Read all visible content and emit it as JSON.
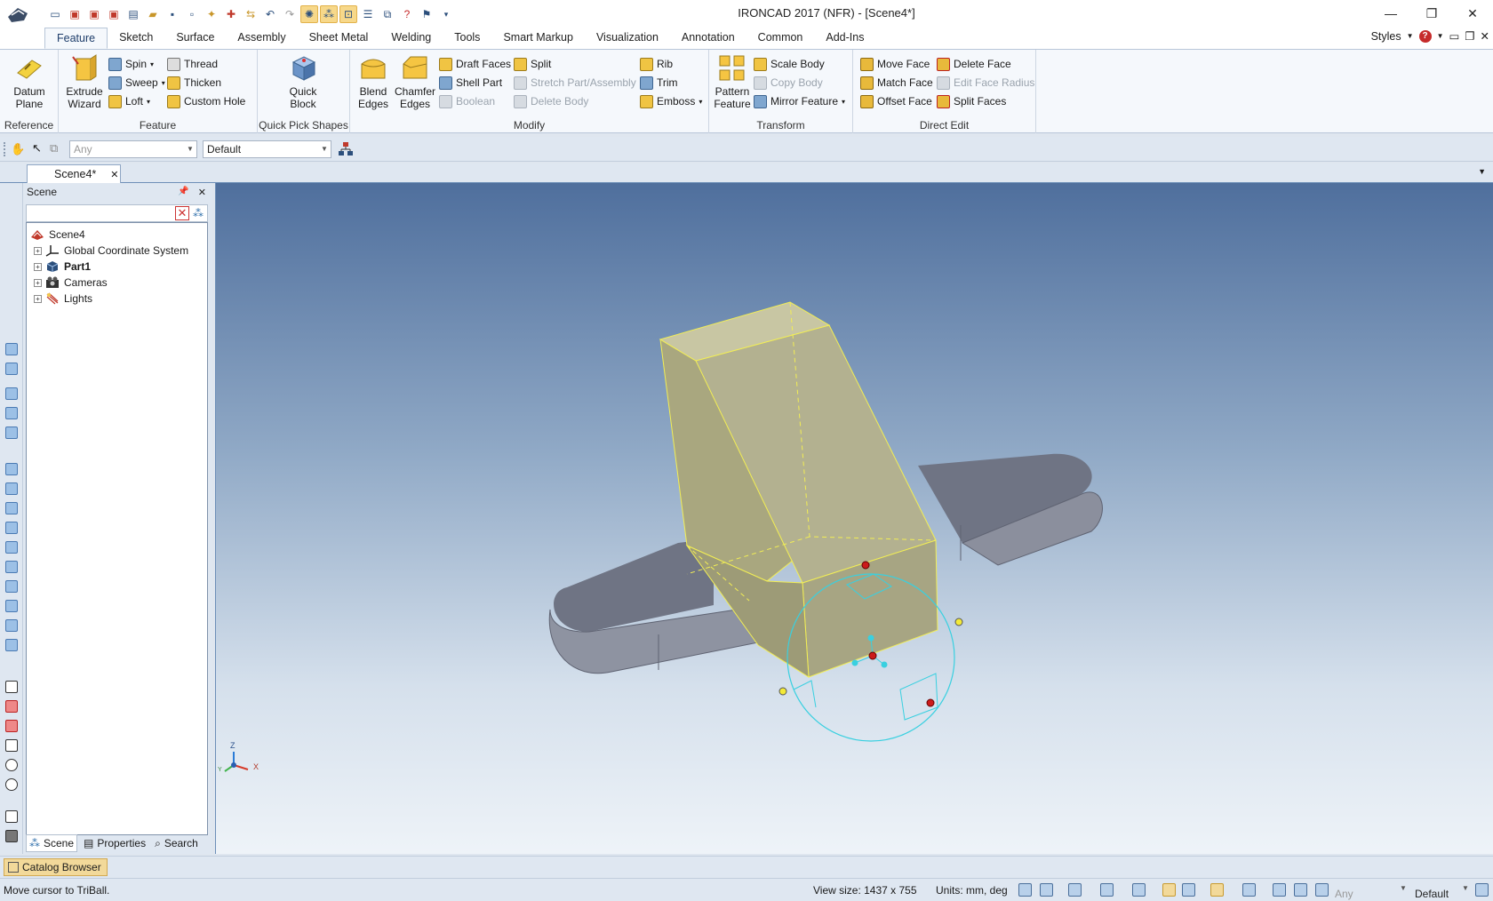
{
  "window": {
    "title": "IRONCAD 2017 (NFR) - [Scene4*]",
    "controls": [
      "minimize-icon",
      "restore-icon",
      "close-icon"
    ]
  },
  "ribbon_tabs": [
    "Feature",
    "Sketch",
    "Surface",
    "Assembly",
    "Sheet Metal",
    "Welding",
    "Tools",
    "Smart Markup",
    "Visualization",
    "Annotation",
    "Common",
    "Add-Ins"
  ],
  "styles_label": "Styles",
  "groups": {
    "reference": {
      "label": "Reference",
      "datum_plane": "Datum\nPlane"
    },
    "feature": {
      "label": "Feature",
      "extrude_wizard": "Extrude\nWizard",
      "spin": "Spin",
      "sweep": "Sweep",
      "loft": "Loft",
      "thread": "Thread",
      "thicken": "Thicken",
      "custom_hole": "Custom Hole"
    },
    "quick_pick": {
      "label": "Quick Pick Shapes",
      "quick_block": "Quick\nBlock"
    },
    "modify": {
      "label": "Modify",
      "blend_edges": "Blend\nEdges",
      "chamfer_edges": "Chamfer\nEdges",
      "draft_faces": "Draft Faces",
      "shell_part": "Shell Part",
      "boolean": "Boolean",
      "split": "Split",
      "stretch": "Stretch Part/Assembly",
      "delete_body": "Delete Body",
      "rib": "Rib",
      "trim": "Trim",
      "emboss": "Emboss"
    },
    "transform": {
      "label": "Transform",
      "pattern_feature": "Pattern\nFeature",
      "scale_body": "Scale Body",
      "copy_body": "Copy Body",
      "mirror_feature": "Mirror Feature"
    },
    "direct_edit": {
      "label": "Direct Edit",
      "move_face": "Move Face",
      "match_face": "Match Face",
      "offset_face": "Offset Face",
      "delete_face": "Delete Face",
      "edit_face_radius": "Edit Face Radius",
      "split_faces": "Split Faces"
    }
  },
  "selection_toolbar": {
    "filter_value": "Any",
    "style_value": "Default"
  },
  "doc_tab": "Scene4*",
  "scene_panel": {
    "title": "Scene",
    "tree": [
      {
        "label": "Scene4",
        "bold": false,
        "icon": "scene-icon"
      },
      {
        "label": "Global Coordinate System",
        "bold": false,
        "icon": "coordinate-system-icon"
      },
      {
        "label": "Part1",
        "bold": true,
        "icon": "part-icon"
      },
      {
        "label": "Cameras",
        "bold": false,
        "icon": "camera-icon"
      },
      {
        "label": "Lights",
        "bold": false,
        "icon": "light-icon"
      }
    ],
    "tabs": [
      "Scene",
      "Properties",
      "Search"
    ]
  },
  "viewport": {
    "axis_labels": {
      "z": "Z",
      "x": "X",
      "y": "Y"
    }
  },
  "catalog_browser": "Catalog Browser",
  "status": {
    "message": "Move cursor to TriBall.",
    "view_size": "View size: 1437 x  755",
    "units": "Units: mm, deg",
    "filter": "Any",
    "style": "Default"
  },
  "colors": {
    "ribbon_bg": "#f5f8fc",
    "selection_yellow": "#f4f264",
    "triball_cyan": "#39d0e0",
    "part_face": "#b4b28a",
    "base_face": "#8a8f9e"
  }
}
